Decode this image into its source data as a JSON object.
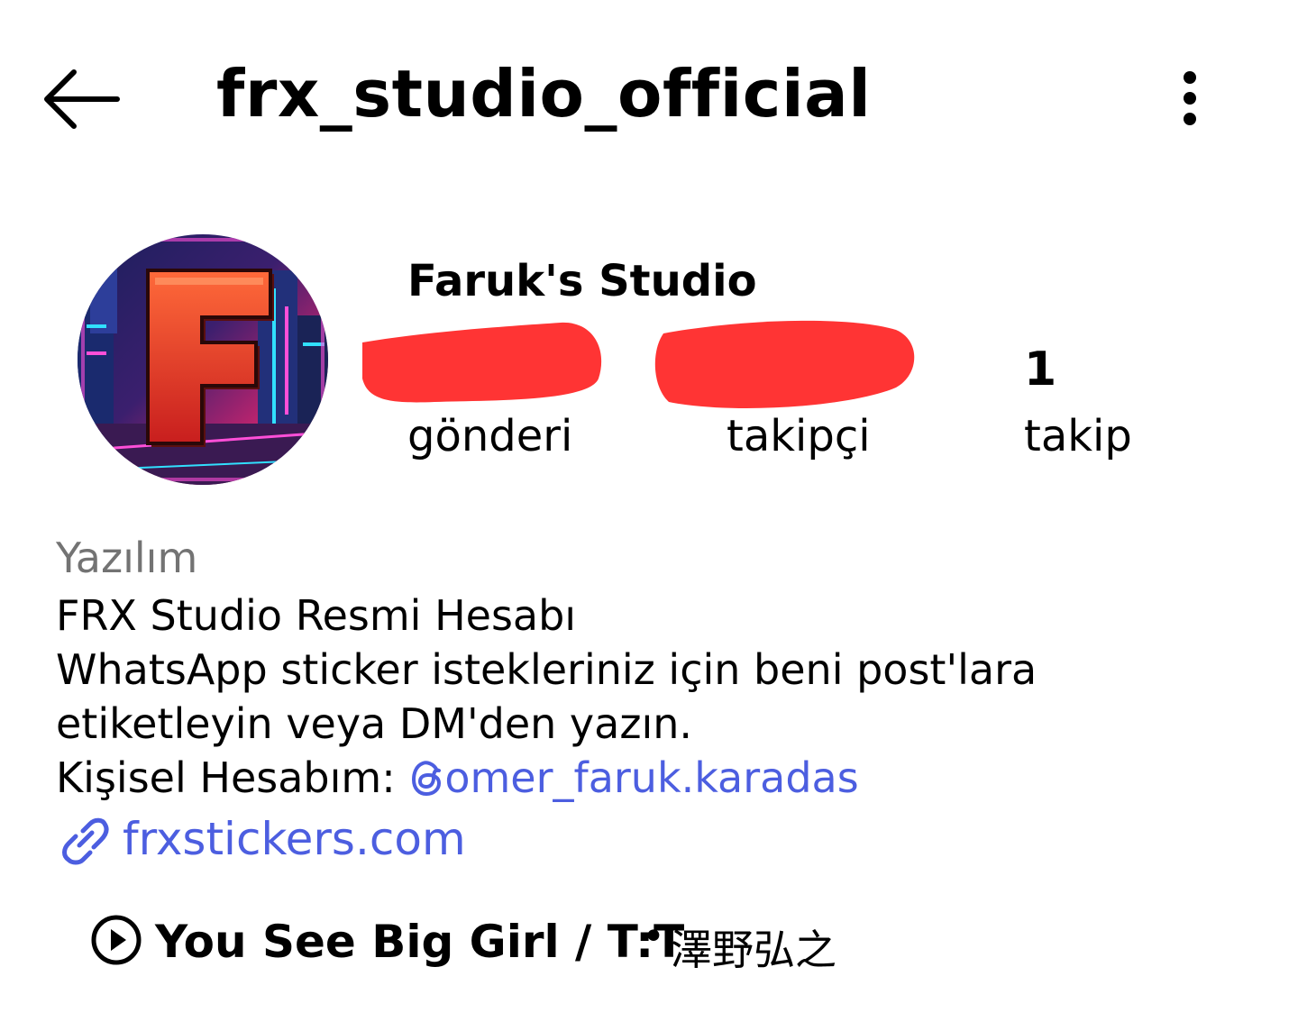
{
  "header": {
    "username": "frx_studio_official",
    "back_icon": "arrow-left-icon",
    "more_icon": "more-vertical-icon"
  },
  "profile": {
    "display_name": "Faruk's Studio",
    "avatar_letter": "F",
    "stats": [
      {
        "value": "",
        "label": "gönderi",
        "redacted": true
      },
      {
        "value": "",
        "label": "takipçi",
        "redacted": true
      },
      {
        "value": "1",
        "label": "takip",
        "redacted": false
      }
    ]
  },
  "bio": {
    "category": "Yazılım",
    "lines": [
      "FRX Studio Resmi Hesabı",
      "WhatsApp sticker istekleriniz için beni post'lara",
      "etiketleyin veya DM'den yazın."
    ],
    "personal_label": "Kişisel Hesabım: ",
    "personal_handle": "omer_faruk.karadas",
    "link": "frxstickers.com"
  },
  "music": {
    "song": "You See Big Girl / T:T",
    "separator": "•",
    "artist": "澤野弘之"
  },
  "colors": {
    "link": "#4c5ee0",
    "secondary_text": "#737373",
    "redaction": "#ff3434"
  }
}
